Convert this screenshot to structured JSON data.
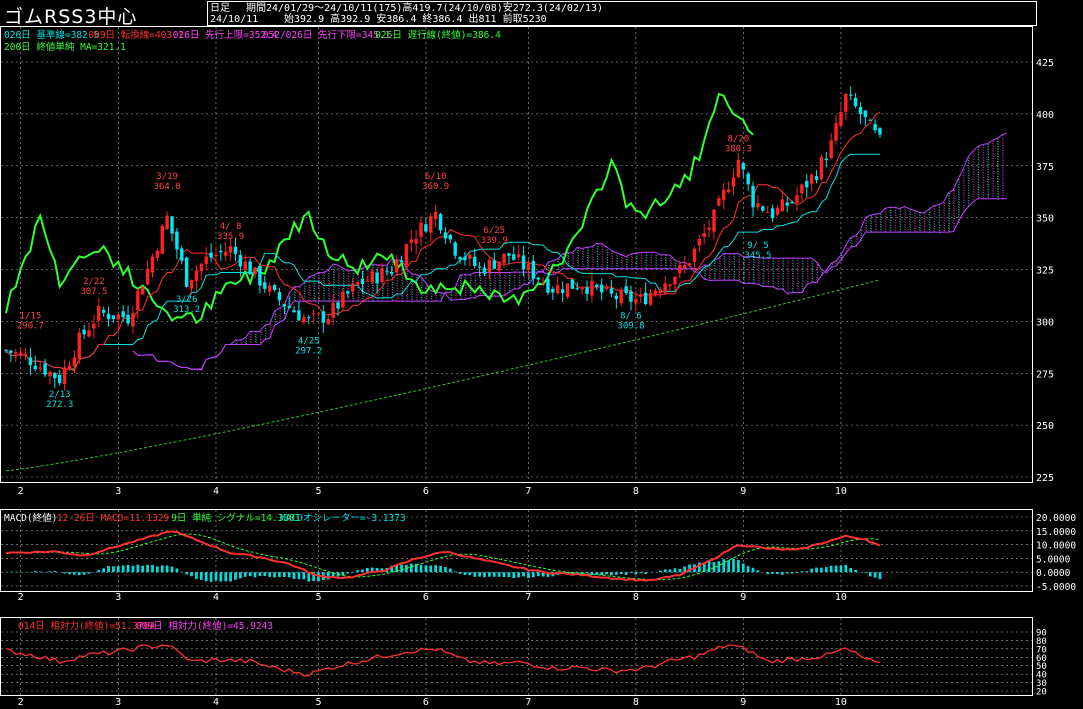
{
  "header": {
    "title": "ゴムRSS3中心",
    "period_type": "日足",
    "period_info": "期間24/01/29～24/10/11(175)高419.7(24/10/08)安272.3(24/02/13)",
    "date": "24/10/11",
    "ohlc_info": "始392.9 高392.9 安386.4 終386.4 出811 前取5230"
  },
  "legend_main": [
    {
      "text": "026日 基準線=382.5",
      "color": "#00e0e0"
    },
    {
      "text": "009日 転換線=403.1",
      "color": "#ff3030"
    },
    {
      "text": "026日 先行上限=352.4",
      "color": "#ff40ff"
    },
    {
      "text": "052/026日 先行下限=345.1",
      "color": "#ff40ff"
    },
    {
      "text": "026日 遅行線(終値)=386.4",
      "color": "#30ff30"
    },
    {
      "text": "200日 終値単純 MA=321.1",
      "color": "#30ff30"
    }
  ],
  "legend_macd": [
    {
      "text": "MACD(終値)",
      "color": "#ffffff"
    },
    {
      "text": "12-26日 MACD=11.1329",
      "color": "#ff3030"
    },
    {
      "text": "9日 単純 シグナル=14.3301",
      "color": "#30ff30"
    },
    {
      "text": "MACDオシレーター=-3.1373",
      "color": "#00e0e0"
    }
  ],
  "legend_rsi": [
    {
      "text": "014日 相対力(終値)=51.3764",
      "color": "#ff3030"
    },
    {
      "text": "009日 相対力(終値)=45.9243",
      "color": "#ff40ff"
    }
  ],
  "colors": {
    "up": "#ff2020",
    "down": "#00e8f0",
    "kijun": "#00e0e0",
    "tenkan": "#ff3030",
    "span": "#c040ff",
    "chikou": "#30ff30",
    "ma": "#30c030",
    "grid": "#b0b0b0"
  },
  "chart_data": {
    "type": "candlestick",
    "x_ticks": [
      {
        "label": "2",
        "index": 3
      },
      {
        "label": "3",
        "index": 23
      },
      {
        "label": "4",
        "index": 43
      },
      {
        "label": "5",
        "index": 64
      },
      {
        "label": "6",
        "index": 86
      },
      {
        "label": "7",
        "index": 107
      },
      {
        "label": "8",
        "index": 129
      },
      {
        "label": "9",
        "index": 151
      },
      {
        "label": "10",
        "index": 171
      }
    ],
    "bar_count": 175,
    "price_ylim": [
      225,
      425
    ],
    "price_yticks": [
      225,
      250,
      275,
      300,
      325,
      350,
      375,
      400,
      425
    ],
    "anchors": [
      [
        0,
        286
      ],
      [
        4,
        283
      ],
      [
        11,
        272.3
      ],
      [
        15,
        291
      ],
      [
        19,
        304
      ],
      [
        25,
        302
      ],
      [
        29,
        325
      ],
      [
        33,
        350
      ],
      [
        37,
        320
      ],
      [
        41,
        330
      ],
      [
        46,
        335
      ],
      [
        50,
        325
      ],
      [
        55,
        312
      ],
      [
        62,
        300
      ],
      [
        66,
        303
      ],
      [
        72,
        318
      ],
      [
        79,
        325
      ],
      [
        83,
        340
      ],
      [
        88,
        352
      ],
      [
        92,
        335
      ],
      [
        97,
        325
      ],
      [
        103,
        332
      ],
      [
        107,
        325
      ],
      [
        112,
        316
      ],
      [
        118,
        318
      ],
      [
        124,
        312
      ],
      [
        130,
        310
      ],
      [
        134,
        318
      ],
      [
        139,
        326
      ],
      [
        145,
        350
      ],
      [
        150,
        378
      ],
      [
        153,
        358
      ],
      [
        157,
        352
      ],
      [
        161,
        358
      ],
      [
        166,
        372
      ],
      [
        169,
        385
      ],
      [
        172,
        408
      ],
      [
        175,
        400
      ],
      [
        179,
        386.4
      ]
    ],
    "annotations": [
      {
        "date": "1/15",
        "price": "290.7",
        "index": 5,
        "value": 290.7,
        "pos": "above",
        "color": "#ff4040"
      },
      {
        "date": "2/13",
        "price": "272.3",
        "index": 11,
        "value": 272.3,
        "pos": "below",
        "color": "#00e0e0"
      },
      {
        "date": "2/22",
        "price": "307.5",
        "index": 18,
        "value": 307.5,
        "pos": "above",
        "color": "#ff4040"
      },
      {
        "date": "3/19",
        "price": "364.0",
        "index": 33,
        "value": 358,
        "pos": "above",
        "color": "#ff4040"
      },
      {
        "date": "3/26",
        "price": "313.2",
        "index": 37,
        "value": 318,
        "pos": "below",
        "color": "#00e0e0"
      },
      {
        "date": "4/ 8",
        "price": "335.9",
        "index": 46,
        "value": 334,
        "pos": "above",
        "color": "#ff4040"
      },
      {
        "date": "4/25",
        "price": "297.2",
        "index": 62,
        "value": 298,
        "pos": "below",
        "color": "#00e0e0"
      },
      {
        "date": "6/10",
        "price": "360.9",
        "index": 88,
        "value": 358,
        "pos": "above",
        "color": "#ff4040"
      },
      {
        "date": "6/25",
        "price": "339.9",
        "index": 100,
        "value": 332,
        "pos": "above",
        "color": "#ff4040"
      },
      {
        "date": "8/ 6",
        "price": "309.8",
        "index": 128,
        "value": 310,
        "pos": "below",
        "color": "#00e0e0"
      },
      {
        "date": "8/20",
        "price": "380.3",
        "index": 150,
        "value": 376,
        "pos": "above",
        "color": "#ff4040"
      },
      {
        "date": "9/ 5",
        "price": "345.5",
        "index": 154,
        "value": 344,
        "pos": "below",
        "color": "#00e0e0"
      }
    ],
    "macd_ylim": [
      -5,
      20
    ],
    "macd_yticks": [
      "20.0000",
      "15.0000",
      "10.0000",
      "5.0000",
      "0.0000",
      "-5.0000"
    ],
    "macd_anchors": [
      [
        0,
        7
      ],
      [
        10,
        7.5
      ],
      [
        16,
        6
      ],
      [
        22,
        9
      ],
      [
        28,
        12
      ],
      [
        34,
        15
      ],
      [
        40,
        11
      ],
      [
        46,
        7
      ],
      [
        52,
        5.5
      ],
      [
        58,
        3
      ],
      [
        64,
        -1.5
      ],
      [
        70,
        -2
      ],
      [
        78,
        1
      ],
      [
        84,
        5
      ],
      [
        90,
        7.5
      ],
      [
        96,
        5
      ],
      [
        104,
        2
      ],
      [
        110,
        0
      ],
      [
        118,
        -1
      ],
      [
        126,
        -2.5
      ],
      [
        132,
        -3
      ],
      [
        138,
        -1
      ],
      [
        144,
        4
      ],
      [
        150,
        10
      ],
      [
        156,
        8.5
      ],
      [
        162,
        8
      ],
      [
        168,
        11
      ],
      [
        172,
        13
      ],
      [
        176,
        12
      ],
      [
        179,
        9.5
      ]
    ],
    "rsi_ylim": [
      20,
      90
    ],
    "rsi_yticks": [
      90,
      80,
      70,
      60,
      50,
      40,
      30,
      20
    ],
    "rsi_anchors": [
      [
        0,
        68
      ],
      [
        6,
        62
      ],
      [
        11,
        55
      ],
      [
        16,
        62
      ],
      [
        22,
        66
      ],
      [
        28,
        72
      ],
      [
        33,
        75
      ],
      [
        38,
        55
      ],
      [
        44,
        57
      ],
      [
        50,
        55
      ],
      [
        56,
        46
      ],
      [
        62,
        40
      ],
      [
        68,
        50
      ],
      [
        76,
        60
      ],
      [
        82,
        67
      ],
      [
        88,
        70
      ],
      [
        94,
        56
      ],
      [
        100,
        52
      ],
      [
        106,
        54
      ],
      [
        112,
        47
      ],
      [
        118,
        48
      ],
      [
        124,
        44
      ],
      [
        130,
        46
      ],
      [
        136,
        55
      ],
      [
        142,
        62
      ],
      [
        148,
        75
      ],
      [
        152,
        68
      ],
      [
        156,
        55
      ],
      [
        162,
        58
      ],
      [
        168,
        62
      ],
      [
        172,
        70
      ],
      [
        176,
        58
      ],
      [
        179,
        51
      ]
    ]
  }
}
